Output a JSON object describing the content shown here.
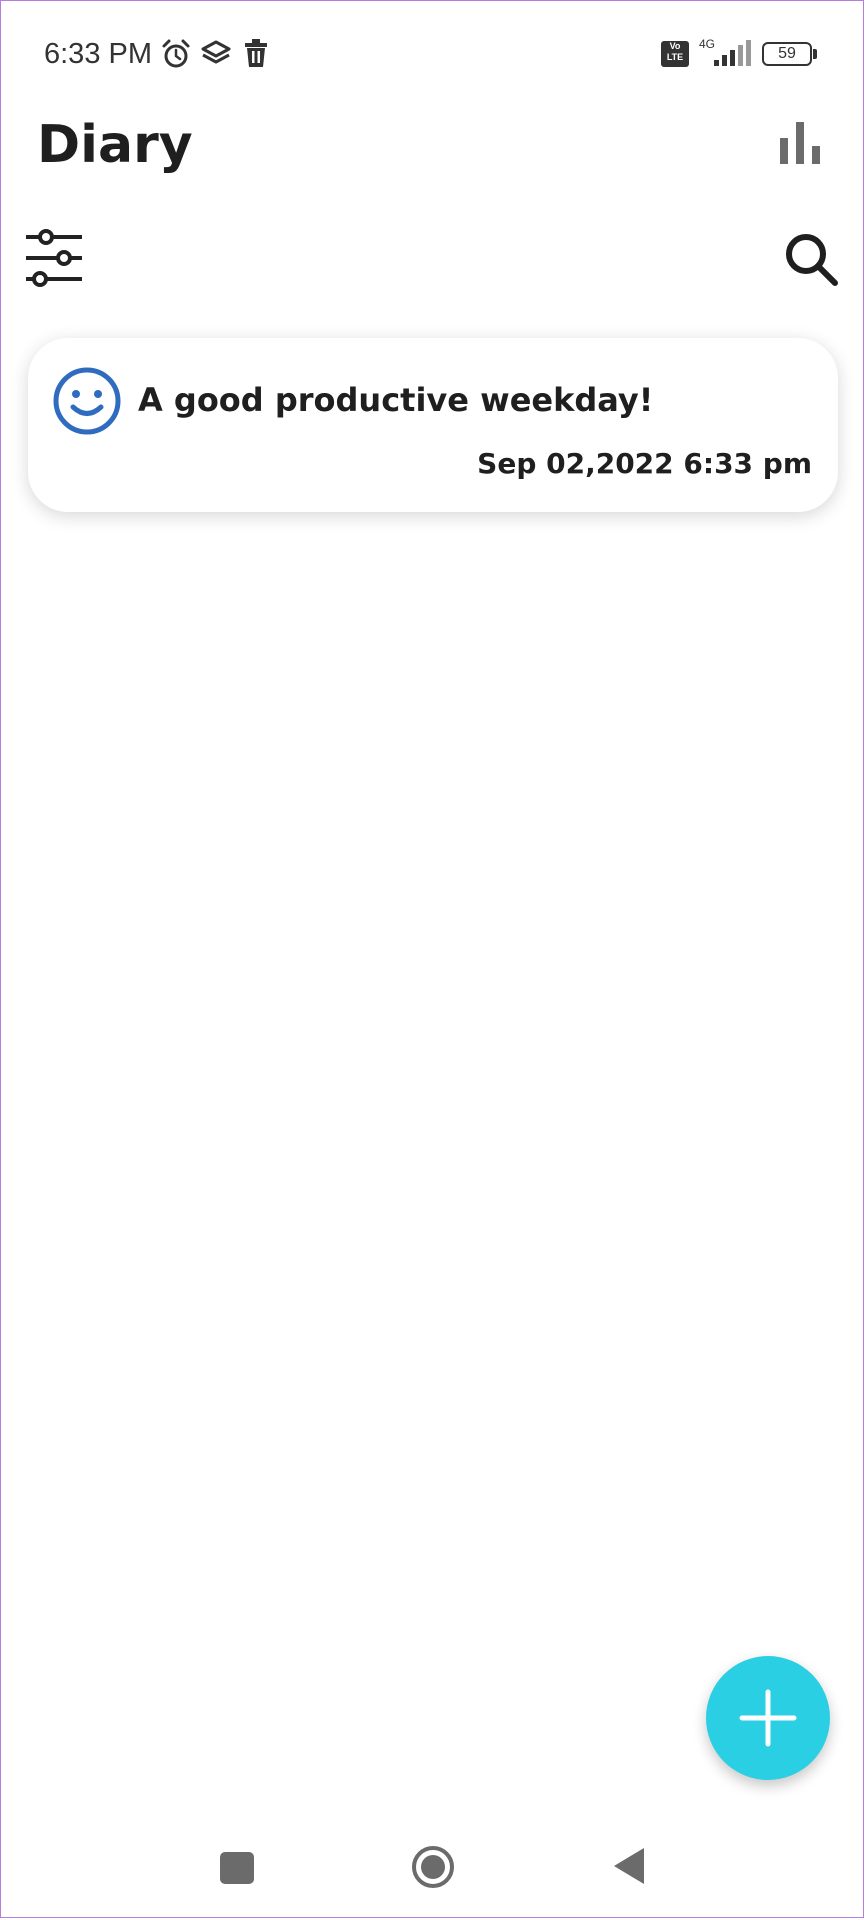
{
  "status_bar": {
    "time": "6:33 PM",
    "icons": [
      "alarm-icon",
      "layers-icon",
      "trash-icon"
    ],
    "volte": "Vo\nLTE",
    "network": "4G",
    "battery": "59"
  },
  "header": {
    "title": "Diary",
    "stats_icon": "bar-chart-icon",
    "filter_icon": "sliders-icon",
    "search_icon": "search-icon"
  },
  "entries": [
    {
      "mood_icon": "smiley-icon",
      "title": "A good productive weekday!",
      "datetime": "Sep 02,2022 6:33 pm"
    }
  ],
  "fab": {
    "icon": "plus-icon"
  },
  "navigation": {
    "recents_icon": "square-icon",
    "home_icon": "circle-icon",
    "back_icon": "triangle-back-icon"
  },
  "colors": {
    "accent": "#2bcfe3",
    "mood": "#2f6bbf",
    "text": "#1f1f1f"
  }
}
